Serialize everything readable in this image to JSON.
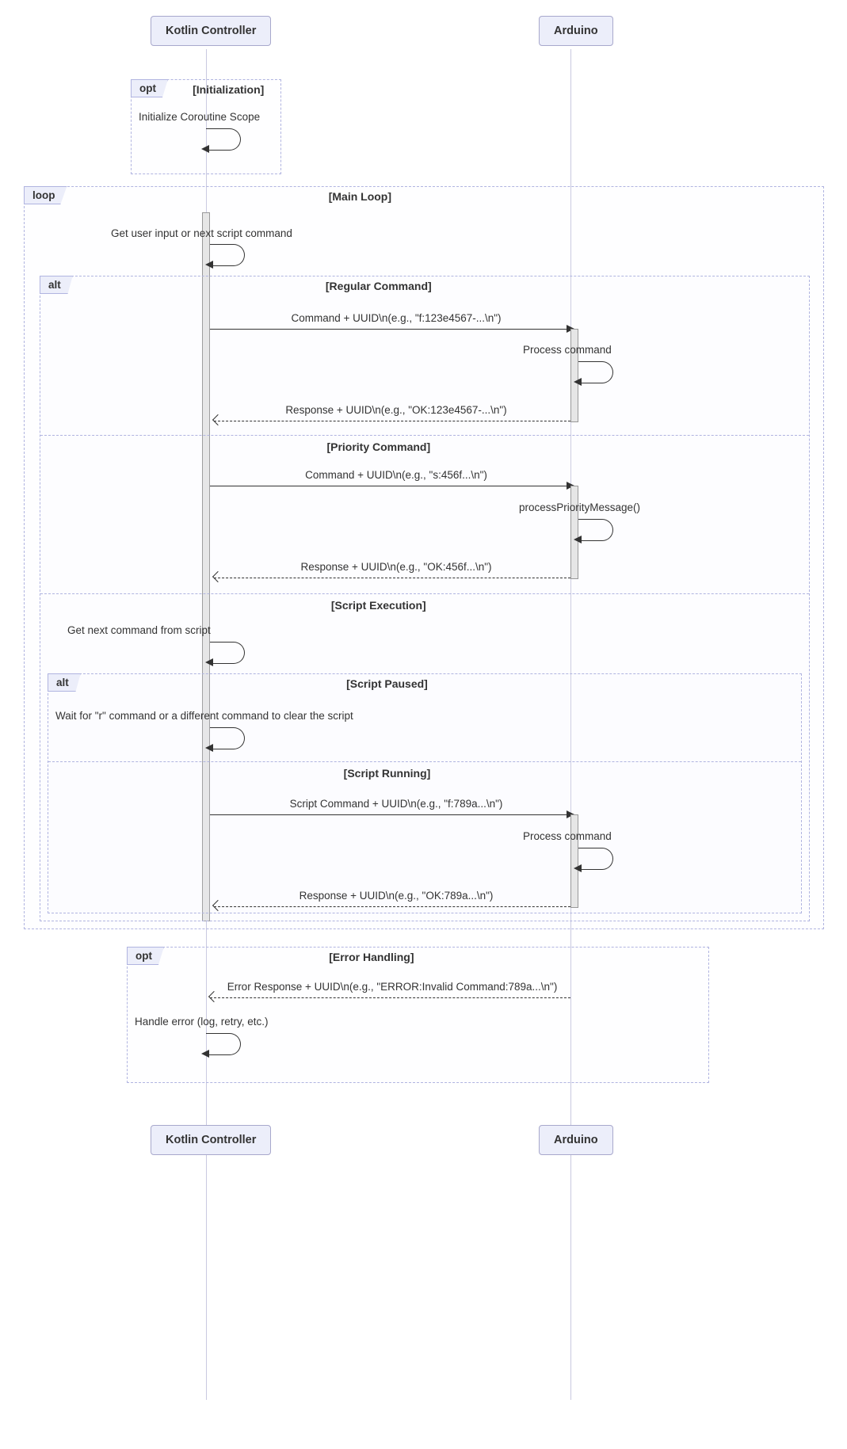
{
  "actors": {
    "kotlin": "Kotlin Controller",
    "arduino": "Arduino"
  },
  "fragments": {
    "opt1": {
      "label": "opt",
      "title": "[Initialization]"
    },
    "loop": {
      "label": "loop",
      "title": "[Main Loop]"
    },
    "alt1": {
      "label": "alt",
      "sections": [
        "[Regular Command]",
        "[Priority Command]",
        "[Script Execution]"
      ]
    },
    "alt2": {
      "label": "alt",
      "sections": [
        "[Script Paused]",
        "[Script Running]"
      ]
    },
    "opt2": {
      "label": "opt",
      "title": "[Error Handling]"
    }
  },
  "messages": {
    "init_scope": "Initialize Coroutine Scope",
    "get_input": "Get user input or next script command",
    "cmd_reg": "Command + UUID\\n(e.g., \"f:123e4567-...\\n\")",
    "proc_cmd": "Process command",
    "resp_reg": "Response + UUID\\n(e.g., \"OK:123e4567-...\\n\")",
    "cmd_pri": "Command + UUID\\n(e.g., \"s:456f...\\n\")",
    "proc_pri": "processPriorityMessage()",
    "resp_pri": "Response + UUID\\n(e.g., \"OK:456f...\\n\")",
    "get_next": "Get next command from script",
    "wait_r": "Wait for \"r\" command or a different command to clear the script",
    "cmd_script": "Script Command + UUID\\n(e.g., \"f:789a...\\n\")",
    "proc_cmd2": "Process command",
    "resp_script": "Response + UUID\\n(e.g., \"OK:789a...\\n\")",
    "err_resp": "Error Response + UUID\\n(e.g., \"ERROR:Invalid Command:789a...\\n\")",
    "handle_err": "Handle error (log, retry, etc.)"
  }
}
